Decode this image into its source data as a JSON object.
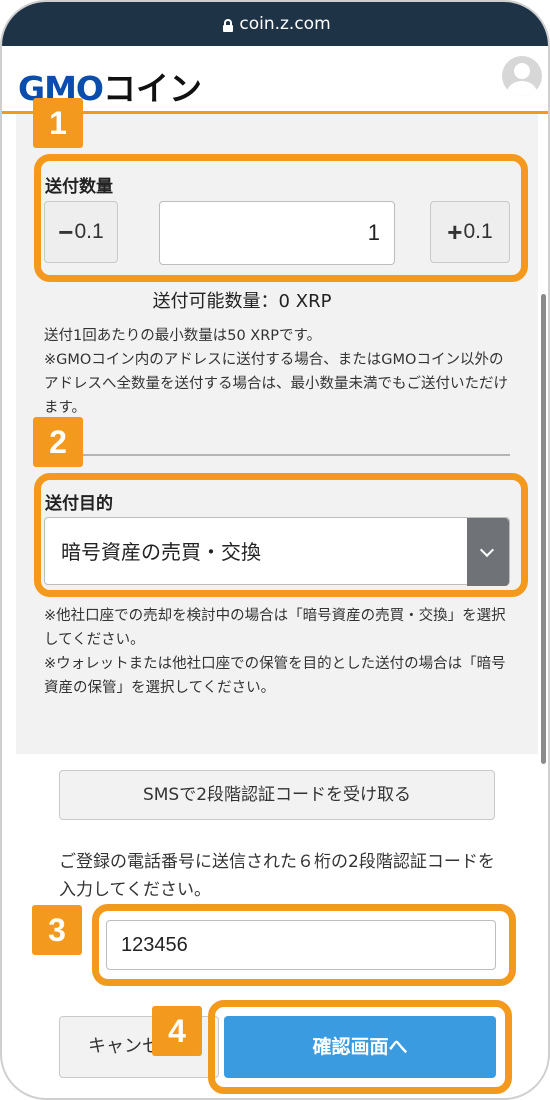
{
  "browser": {
    "url": "coin.z.com"
  },
  "header": {
    "logo_gmo": "GMO",
    "logo_coin": "コイン"
  },
  "badges": [
    "1",
    "2",
    "3",
    "4"
  ],
  "quantity": {
    "label": "送付数量",
    "minus_sign": "−",
    "minus_value": "0.1",
    "plus_sign": "+",
    "plus_value": "0.1",
    "value": "1",
    "available": "送付可能数量：0 XRP"
  },
  "notes": {
    "min_amount": "送付1回あたりの最小数量は50 XRPです。",
    "exception": "※GMOコイン内のアドレスに送付する場合、またはGMOコイン以外のアドレスへ全数量を送付する場合は、最小数量未満でもご送付いただけます。"
  },
  "purpose": {
    "label": "送付目的",
    "selected": "暗号資産の売買・交換",
    "note1": "※他社口座での売却を検討中の場合は「暗号資産の売買・交換」を選択してください。",
    "note2": "※ウォレットまたは他社口座での保管を目的とした送付の場合は「暗号資産の保管」を選択してください。"
  },
  "sms": {
    "button_label": "SMSで2段階認証コードを受け取る",
    "instruction": "ご登録の電話番号に送信された６桁の2段階認証コードを入力してください。",
    "code_value": "123456"
  },
  "actions": {
    "cancel_label": "キャンセル",
    "confirm_label": "確認画面へ"
  },
  "colors": {
    "accent": "#f39a1e",
    "primary": "#3a9be0",
    "urlbar": "#1e3346",
    "logo_blue": "#0a4dab"
  }
}
